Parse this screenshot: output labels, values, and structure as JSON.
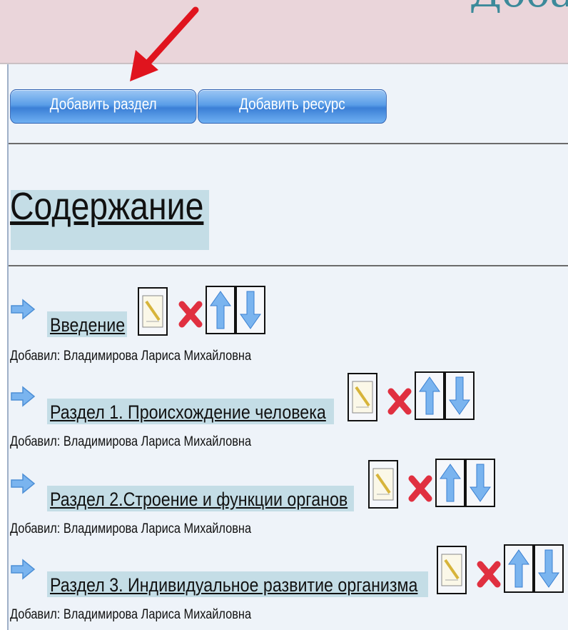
{
  "header": {
    "partial_title": "Доба"
  },
  "toolbar": {
    "add_section_label": "Добавить раздел",
    "add_resource_label": "Добавить ресурс"
  },
  "content": {
    "heading": "Содержание",
    "items": [
      {
        "title": "Введение",
        "added_by": "Добавил: Владимирова Лариса Михайловна"
      },
      {
        "title": "Раздел 1. Происхождение человека",
        "added_by": "Добавил: Владимирова Лариса Михайловна"
      },
      {
        "title": "Раздел 2.Строение и функции органов",
        "added_by": "Добавил: Владимирова Лариса Михайловна"
      },
      {
        "title": "Раздел 3. Индивидуальное развитие организма",
        "added_by": "Добавил: Владимирова Лариса Михайловна"
      }
    ]
  },
  "icons": {
    "bullet": "arrow-right-icon",
    "edit": "edit-notepad-icon",
    "delete": "delete-x-icon",
    "move_up": "arrow-up-icon",
    "move_down": "arrow-down-icon",
    "annotation": "red-pointer-arrow-icon"
  },
  "colors": {
    "header_band": "#ead5da",
    "title_teal": "#3c8a9a",
    "panel_bg": "#eef3f9",
    "button_blue": "#3b7fd6",
    "link_highlight": "#c4dde6",
    "annotation_red": "#e0141e"
  }
}
